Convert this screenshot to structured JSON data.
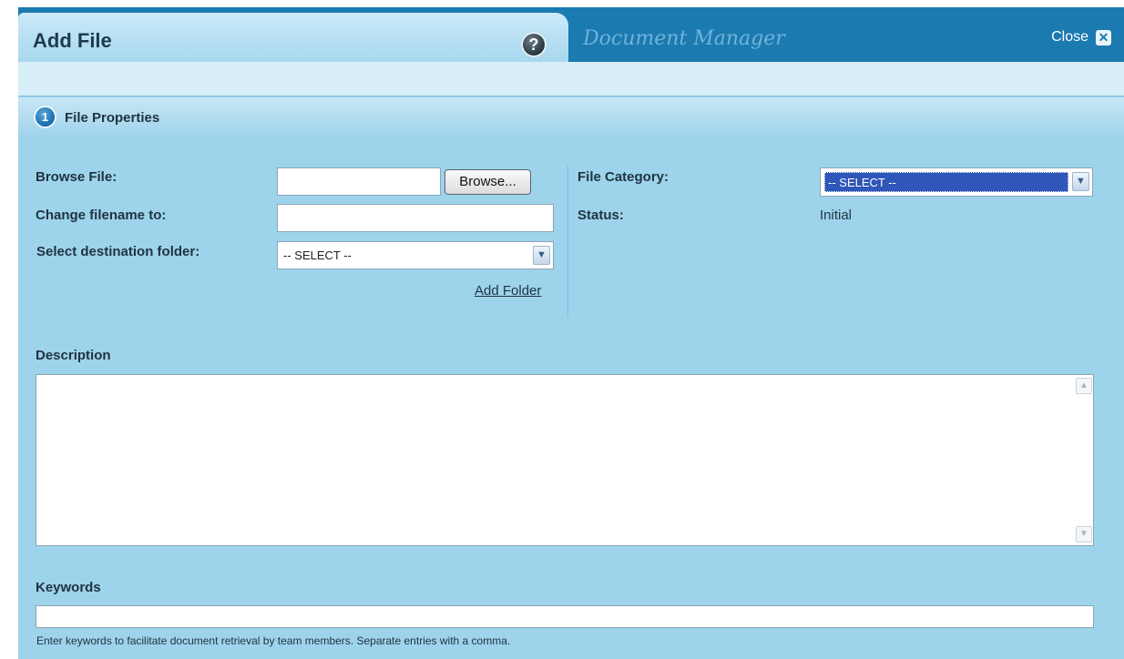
{
  "header": {
    "title": "Add File",
    "help_icon": "question-mark-icon",
    "app_name": "Document Manager",
    "close_label": "Close",
    "close_icon": "x-box-icon",
    "colors": {
      "header_bg": "#1b7ab0",
      "panel_bg": "#9ed3ec"
    }
  },
  "section": {
    "step_number": "1",
    "title": "File Properties"
  },
  "form": {
    "browse_label": "Browse File:",
    "browse_value": "",
    "browse_button": "Browse...",
    "rename_label": "Change filename to:",
    "rename_value": "",
    "folder_label": "Select destination folder:",
    "folder_selected": "-- SELECT --",
    "add_folder_link": "Add Folder",
    "category_label": "File Category:",
    "category_selected": "-- SELECT --",
    "status_label": "Status:",
    "status_value": "Initial",
    "description_label": "Description",
    "description_value": "",
    "keywords_label": "Keywords",
    "keywords_value": "",
    "keywords_hint": "Enter keywords to facilitate document retrieval by team members. Separate entries with a comma."
  }
}
